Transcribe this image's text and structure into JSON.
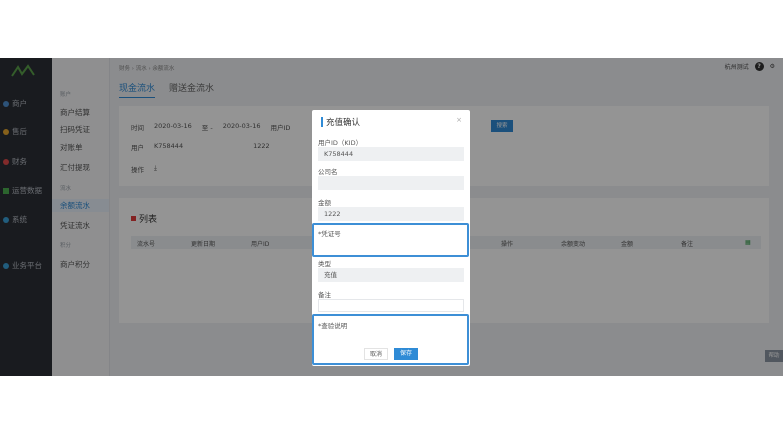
{
  "nav": {
    "items": [
      "商户",
      "售后",
      "财务",
      "运营数据",
      "系统",
      "业务平台"
    ],
    "colors": [
      "#4e8fd1",
      "#e8a830",
      "#e04a4a",
      "#4caf50",
      "#3aa0d8",
      "#3aa0d8"
    ]
  },
  "subnav": {
    "group1": "账户",
    "group1_items": [
      "商户结算",
      "扫码凭证",
      "对账单",
      "汇付提现"
    ],
    "group2": "流水",
    "group2_items": [
      "余额流水",
      "凭证流水"
    ],
    "group3": "积分",
    "group3_items": [
      "商户积分"
    ]
  },
  "breadcrumb": "财务 › 流水 › 余额流水",
  "topright": {
    "user": "杭州测试",
    "help_icon": "?",
    "gear_icon": "⚙"
  },
  "tabs": [
    "现金流水",
    "赠送金流水"
  ],
  "filters": {
    "row1": [
      "时间",
      "2020-03-16",
      "至 -",
      "2020-03-16",
      "用户ID"
    ],
    "row2": [
      "用户",
      "K758444",
      "1222"
    ],
    "row3": [
      "操作"
    ],
    "search": "搜索"
  },
  "list": {
    "title": "列表",
    "headers": [
      "流水号",
      "更新日期",
      "用户ID",
      "操作",
      "余额变动",
      "金额",
      "备注"
    ]
  },
  "help_tab": "帮助",
  "modal": {
    "title": "充值确认",
    "close": "×",
    "fields": [
      {
        "label": "用户ID（KID）",
        "value": "K758444"
      },
      {
        "label": "公司名",
        "value": ""
      },
      {
        "label": "金额",
        "value": "1222"
      },
      {
        "label": "*凭证号",
        "value": ""
      },
      {
        "label": "类型",
        "value": "充值"
      },
      {
        "label": "备注",
        "value": ""
      },
      {
        "label": "*查验说明",
        "value": ""
      }
    ],
    "cancel": "取消",
    "save": "保存"
  }
}
